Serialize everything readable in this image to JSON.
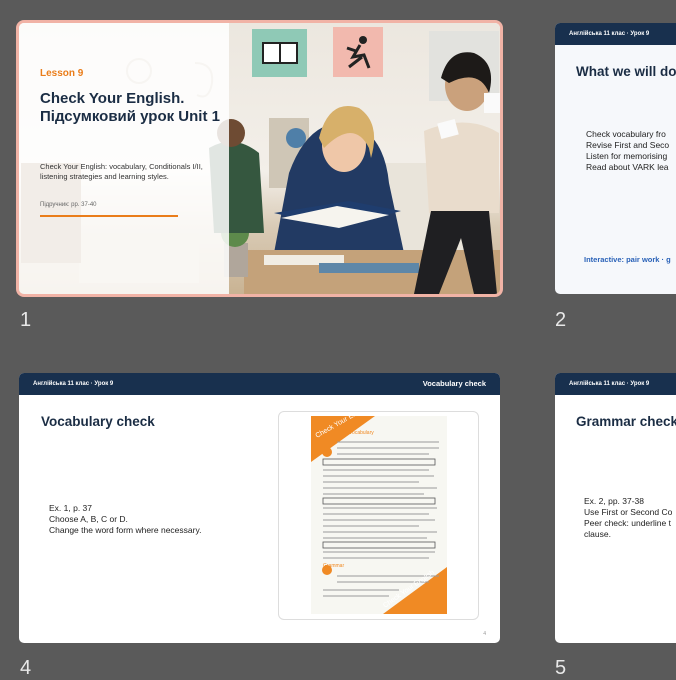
{
  "slides": [
    {
      "number": "1",
      "lesson": "Lesson 9",
      "title": "Check Your English. Підсумковий урок Unit 1",
      "description": "Check Your English: vocabulary, Conditionals I/II, listening strategies and learning styles.",
      "pages": "Підручник: pp. 37-40"
    },
    {
      "number": "2",
      "header": "Англійська 11 клас · Урок 9",
      "title": "What we will do",
      "bullets": [
        "Check vocabulary fro",
        "Revise First and Seco",
        "Listen for memorising",
        "Read about VARK lea"
      ],
      "interactive": "Interactive: pair work · g"
    },
    {
      "number": "4",
      "header": "Англійська 11 клас · Урок 9",
      "tag": "Vocabulary check",
      "title": "Vocabulary check",
      "lines": [
        "Ex. 1, p. 37",
        "Choose A, B, C or D.",
        "Change the word form where necessary."
      ],
      "page_no": "4"
    },
    {
      "number": "5",
      "header": "Англійська 11 клас · Урок 9",
      "title": "Grammar check",
      "lines": [
        "Ex. 2, pp. 37-38",
        "Use First or Second Co",
        "Peer check: underline t",
        "clause."
      ]
    }
  ],
  "textbook": {
    "banner": "Check Your English",
    "section": "Vocabulary",
    "grammar": "Grammar",
    "footer": "Check Your English"
  },
  "colors": {
    "navy": "#18304e",
    "orange": "#ea7d1a",
    "accent_blue": "#2a62b8"
  }
}
